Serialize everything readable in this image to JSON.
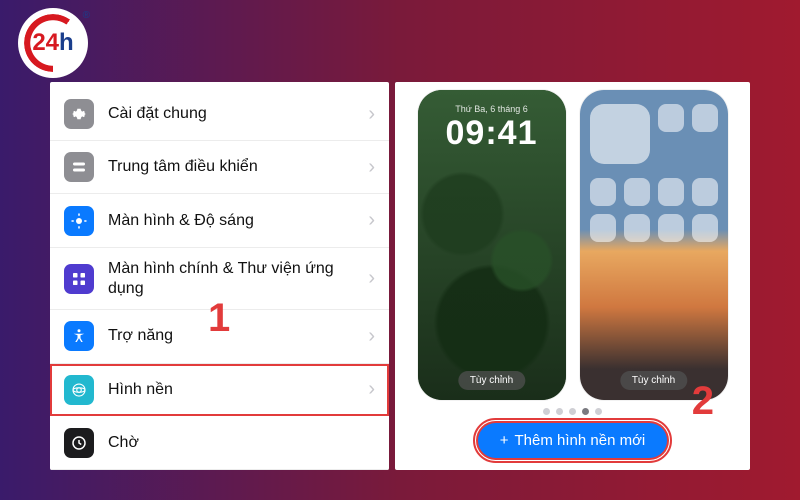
{
  "logo": {
    "text_main": "24",
    "text_suffix": "h",
    "reg": "®"
  },
  "settings": {
    "items": [
      {
        "label": "Cài đặt chung"
      },
      {
        "label": "Trung tâm điều khiển"
      },
      {
        "label": "Màn hình & Độ sáng"
      },
      {
        "label": "Màn hình chính & Thư viện ứng dụng"
      },
      {
        "label": "Trợ năng"
      },
      {
        "label": "Hình nền"
      },
      {
        "label": "Chờ"
      }
    ],
    "callout": "1"
  },
  "wallpaper": {
    "lock": {
      "date": "Thứ Ba, 6 tháng 6",
      "time": "09:41",
      "customize": "Tùy chỉnh"
    },
    "home": {
      "customize": "Tùy chỉnh"
    },
    "add_button": "Thêm hình nền mới",
    "callout": "2"
  }
}
